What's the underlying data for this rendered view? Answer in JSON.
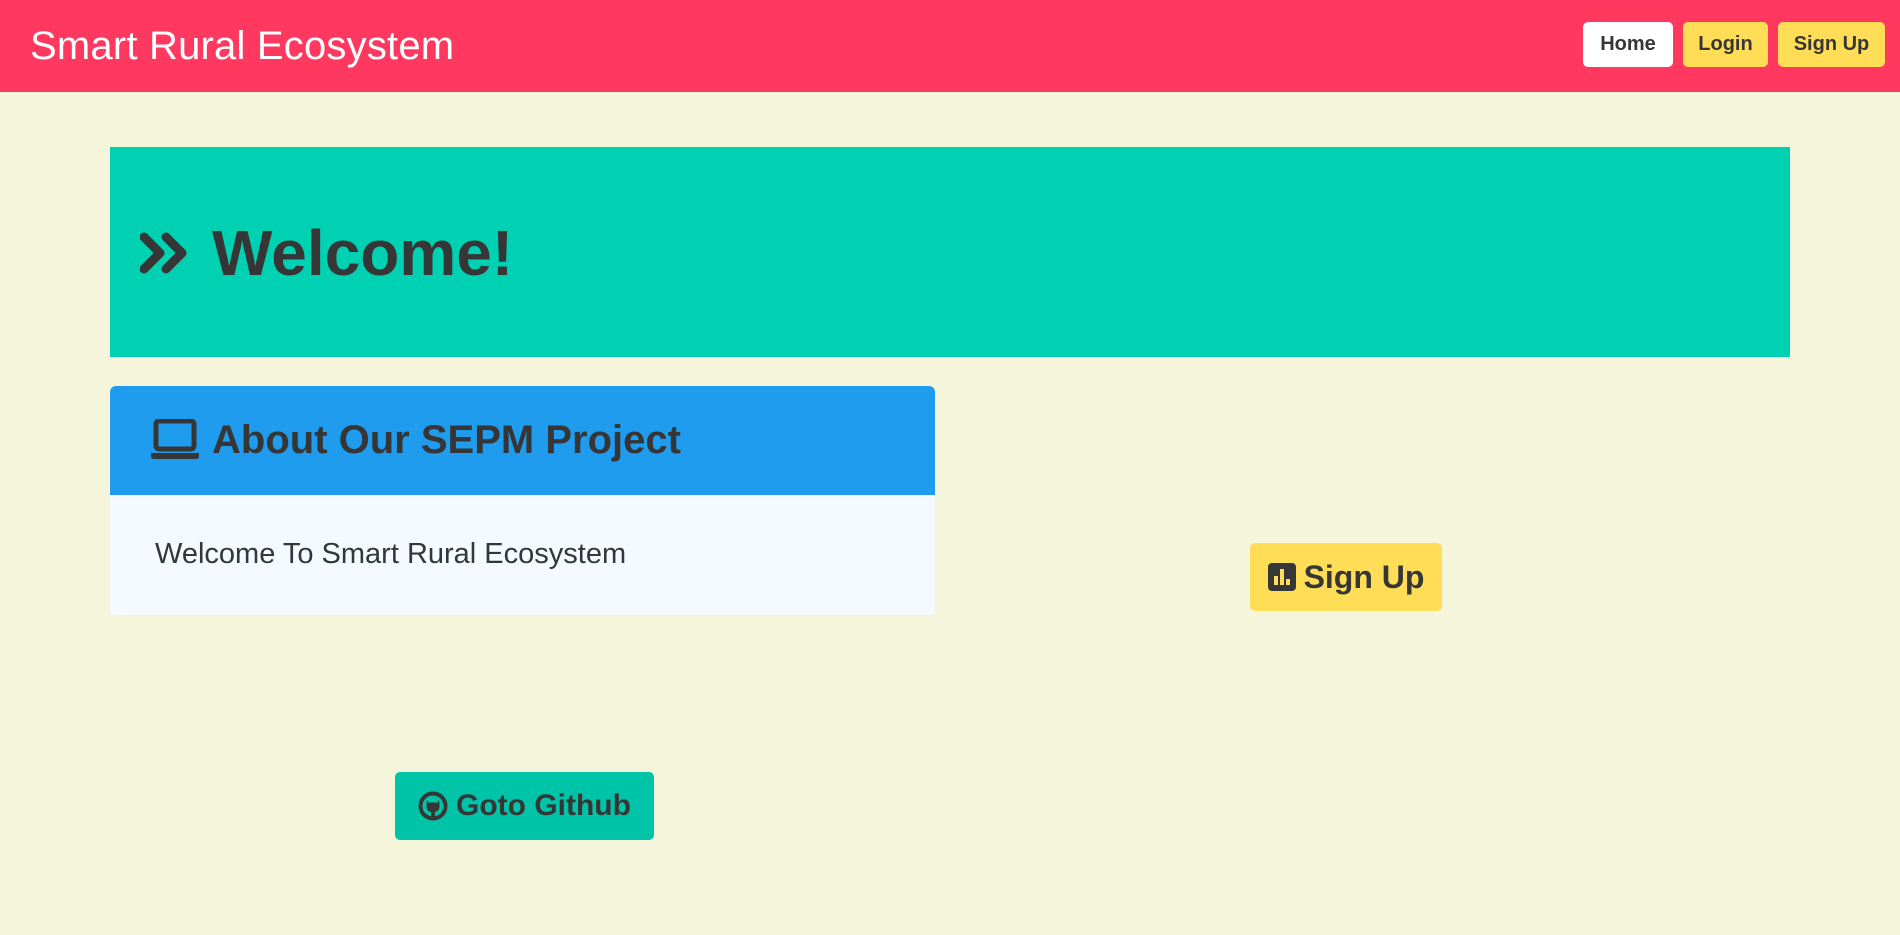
{
  "navbar": {
    "brand": "Smart Rural Ecosystem",
    "items": [
      {
        "label": "Home"
      },
      {
        "label": "Login"
      },
      {
        "label": "Sign Up"
      }
    ]
  },
  "hero": {
    "icon": "angles-right-icon",
    "title": "Welcome!"
  },
  "about_card": {
    "icon": "laptop-icon",
    "title": "About Our SEPM Project",
    "body": "Welcome To Smart Rural Ecosystem"
  },
  "signup_button": {
    "icon": "chart-square-icon",
    "label": "Sign Up"
  },
  "github_button": {
    "icon": "github-icon",
    "label": "Goto Github"
  },
  "colors": {
    "navbar": "#ff3860",
    "page_background": "#f5f5dc",
    "hero": "#00d1b2",
    "card_header": "#209cee",
    "card_body": "#f4faff",
    "warning": "#ffdd57",
    "github_button": "#00c4a7",
    "text": "#363636"
  }
}
